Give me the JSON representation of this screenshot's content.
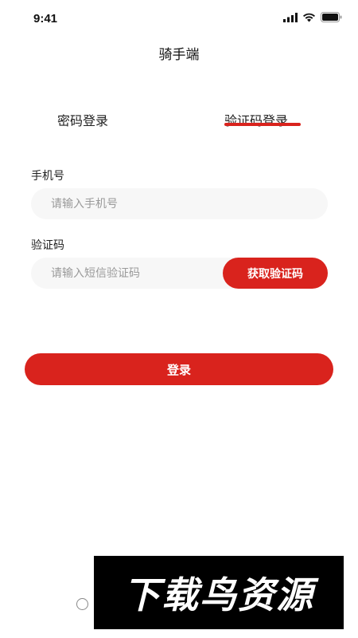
{
  "status_bar": {
    "time": "9:41"
  },
  "nav": {
    "title": "骑手端"
  },
  "tabs": {
    "password_login": "密码登录",
    "code_login": "验证码登录",
    "active": "code_login"
  },
  "form": {
    "phone_label": "手机号",
    "phone_placeholder": "请输入手机号",
    "code_label": "验证码",
    "code_placeholder": "请输入短信验证码",
    "get_code_label": "获取验证码"
  },
  "login_button": {
    "label": "登录"
  },
  "watermark": {
    "text": "下载鸟资源"
  },
  "colors": {
    "accent": "#d9231d",
    "input_bg": "#f7f7f7"
  }
}
